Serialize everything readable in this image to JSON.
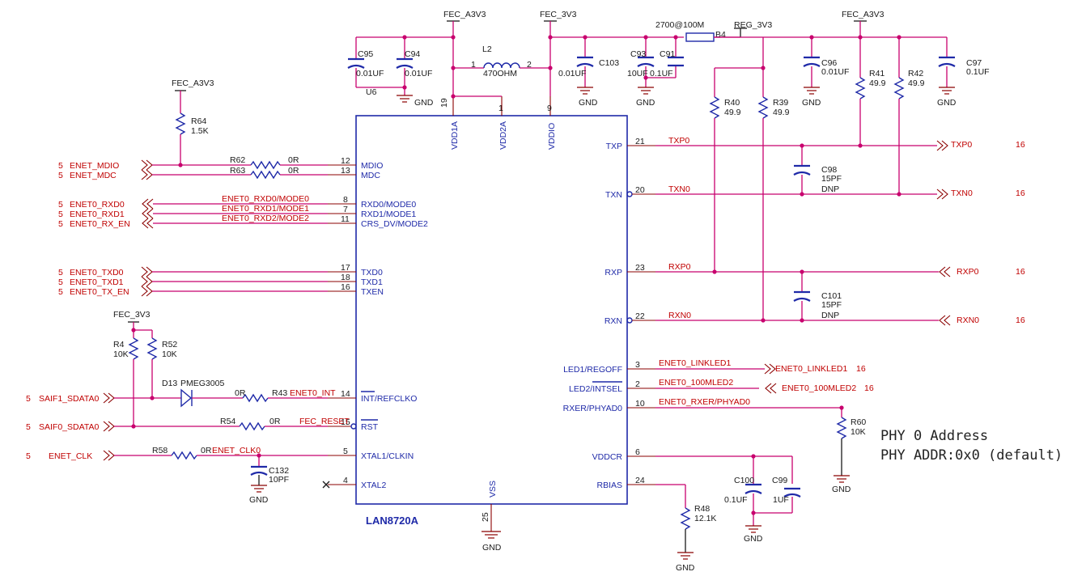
{
  "schematic": {
    "chip": {
      "name": "LAN8720A"
    },
    "power": {
      "fec_a3v3": "FEC_A3V3",
      "fec_3v3": "FEC_3V3",
      "reg_3v3": "REG_3V3",
      "gnd": "GND"
    },
    "inductor": {
      "ref": "L2",
      "value": "470OHM",
      "pin1": "1",
      "pin2": "2"
    },
    "bead": {
      "ref": "B4",
      "value": "2700@100M"
    },
    "u6": "U6",
    "top_pins": [
      {
        "num": "19",
        "name": "VDD1A"
      },
      {
        "num": "1",
        "name": "VDD2A"
      },
      {
        "num": "9",
        "name": "VDDIO"
      }
    ],
    "bottom_pin": {
      "num": "25",
      "name": "VSS"
    },
    "left_pins": [
      {
        "num": "12",
        "name": "MDIO"
      },
      {
        "num": "13",
        "name": "MDC"
      },
      {
        "num": "8",
        "name": "RXD0/MODE0"
      },
      {
        "num": "7",
        "name": "RXD1/MODE1"
      },
      {
        "num": "11",
        "name": "CRS_DV/MODE2"
      },
      {
        "num": "17",
        "name": "TXD0"
      },
      {
        "num": "18",
        "name": "TXD1"
      },
      {
        "num": "16",
        "name": "TXEN"
      },
      {
        "num": "14",
        "name": "INT/REFCLKO"
      },
      {
        "num": "15",
        "name": "RST"
      },
      {
        "num": "5",
        "name": "XTAL1/CLKIN"
      },
      {
        "num": "4",
        "name": "XTAL2"
      }
    ],
    "right_pins": [
      {
        "num": "21",
        "name": "TXP"
      },
      {
        "num": "20",
        "name": "TXN"
      },
      {
        "num": "23",
        "name": "RXP"
      },
      {
        "num": "22",
        "name": "RXN"
      },
      {
        "num": "3",
        "name": "LED1/REGOFF"
      },
      {
        "num": "2",
        "name": "LED2/INTSEL"
      },
      {
        "num": "10",
        "name": "RXER/PHYAD0"
      },
      {
        "num": "6",
        "name": "VDDCR"
      },
      {
        "num": "24",
        "name": "RBIAS"
      }
    ],
    "left_ports": [
      {
        "sheet": "5",
        "name": "ENET_MDIO"
      },
      {
        "sheet": "5",
        "name": "ENET_MDC"
      },
      {
        "sheet": "5",
        "name": "ENET0_RXD0"
      },
      {
        "sheet": "5",
        "name": "ENET0_RXD1"
      },
      {
        "sheet": "5",
        "name": "ENET0_RX_EN"
      },
      {
        "sheet": "5",
        "name": "ENET0_TXD0"
      },
      {
        "sheet": "5",
        "name": "ENET0_TXD1"
      },
      {
        "sheet": "5",
        "name": "ENET0_TX_EN"
      },
      {
        "sheet": "5",
        "name": "SAIF1_SDATA0"
      },
      {
        "sheet": "5",
        "name": "SAIF0_SDATA0"
      },
      {
        "sheet": "5",
        "name": "ENET_CLK"
      }
    ],
    "left_nets": [
      "ENET0_RXD0/MODE0",
      "ENET0_RXD1/MODE1",
      "ENET0_RXD2/MODE2",
      "ENET0_INT",
      "FEC_RESET",
      "ENET_CLK0"
    ],
    "right_nets": [
      "TXP0",
      "TXN0",
      "RXP0",
      "RXN0",
      "ENET0_LINKLED1",
      "ENET0_100MLED2",
      "ENET0_RXER/PHYAD0"
    ],
    "right_ports": [
      {
        "name": "TXP0",
        "sheet": "16"
      },
      {
        "name": "TXN0",
        "sheet": "16"
      },
      {
        "name": "RXP0",
        "sheet": "16"
      },
      {
        "name": "RXN0",
        "sheet": "16"
      },
      {
        "name": "ENET0_LINKLED1",
        "sheet": "16"
      },
      {
        "name": "ENET0_100MLED2",
        "sheet": "16"
      }
    ],
    "resistors": {
      "R64": {
        "ref": "R64",
        "value": "1.5K"
      },
      "R62": {
        "ref": "R62",
        "value": "0R"
      },
      "R63": {
        "ref": "R63",
        "value": "0R"
      },
      "R4": {
        "ref": "R4",
        "value": "10K"
      },
      "R52": {
        "ref": "R52",
        "value": "10K"
      },
      "R43": {
        "ref": "R43",
        "value": "0R"
      },
      "R54": {
        "ref": "R54",
        "value": "0R"
      },
      "R58": {
        "ref": "R58",
        "value": "0R"
      },
      "R40": {
        "ref": "R40",
        "value": "49.9"
      },
      "R39": {
        "ref": "R39",
        "value": "49.9"
      },
      "R41": {
        "ref": "R41",
        "value": "49.9"
      },
      "R42": {
        "ref": "R42",
        "value": "49.9"
      },
      "R60": {
        "ref": "R60",
        "value": "10K"
      },
      "R48": {
        "ref": "R48",
        "value": "12.1K"
      }
    },
    "capacitors": {
      "C95": {
        "ref": "C95",
        "value": "0.01UF"
      },
      "C94": {
        "ref": "C94",
        "value": "0.01UF"
      },
      "C103": {
        "ref": "C103",
        "value": "0.01UF"
      },
      "C93": {
        "ref": "C93",
        "value": "10UF"
      },
      "C91": {
        "ref": "C91",
        "value": "0.1UF"
      },
      "C96": {
        "ref": "C96",
        "value": "0.01UF"
      },
      "C97": {
        "ref": "C97",
        "value": "0.1UF"
      },
      "C98": {
        "ref": "C98",
        "value": "15PF",
        "note": "DNP"
      },
      "C101": {
        "ref": "C101",
        "value": "15PF",
        "note": "DNP"
      },
      "C132": {
        "ref": "C132",
        "value": "10PF"
      },
      "C100": {
        "ref": "C100",
        "value": "0.1UF"
      },
      "C99": {
        "ref": "C99",
        "value": "1UF"
      }
    },
    "diode": {
      "ref": "D13",
      "value": "PMEG3005"
    },
    "notes": {
      "line1": "PHY 0  Address",
      "line2": "PHY ADDR:0x0 (default)"
    }
  }
}
